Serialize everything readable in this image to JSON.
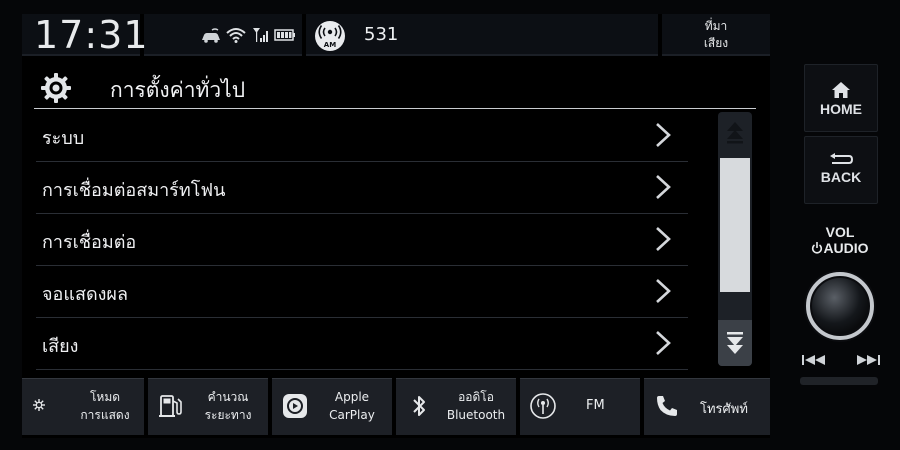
{
  "status": {
    "time": "17:31",
    "band_badge": "AM",
    "frequency": "531",
    "source_button": [
      "ที่มา",
      "เสียง"
    ],
    "icons": [
      "car-signal-icon",
      "wifi-icon",
      "cell-signal-icon",
      "battery-icon",
      "radio-am-icon"
    ]
  },
  "header": {
    "title": "การตั้งค่าทั่วไป",
    "icon": "gear-icon"
  },
  "menu": {
    "items": [
      {
        "label": "ระบบ"
      },
      {
        "label": "การเชื่อมต่อสมาร์ทโฟน"
      },
      {
        "label": "การเชื่อมต่อ"
      },
      {
        "label": "จอแสดงผล"
      },
      {
        "label": "เสียง"
      }
    ]
  },
  "scrollbar": {
    "position_fraction": 0.25,
    "icons": [
      "scroll-up-icon",
      "scroll-down-icon"
    ]
  },
  "bottom": {
    "display_mode": [
      "โหมด",
      "การแสดง"
    ],
    "fuel_calc": [
      "คำนวณ",
      "ระยะทาง"
    ],
    "carplay": [
      "Apple",
      "CarPlay"
    ],
    "bluetooth_audio": [
      "ออดิโอ",
      "Bluetooth"
    ],
    "fm": "FM",
    "phone": "โทรศัพท์"
  },
  "hardware": {
    "home": "HOME",
    "back": "BACK",
    "vol_line1": "VOL",
    "vol_line2": "AUDIO"
  },
  "colors": {
    "screen_bg": "#000000",
    "button_bg": "#1d2026",
    "thumb": "#d7dadd",
    "text": "#f0f1f3"
  }
}
